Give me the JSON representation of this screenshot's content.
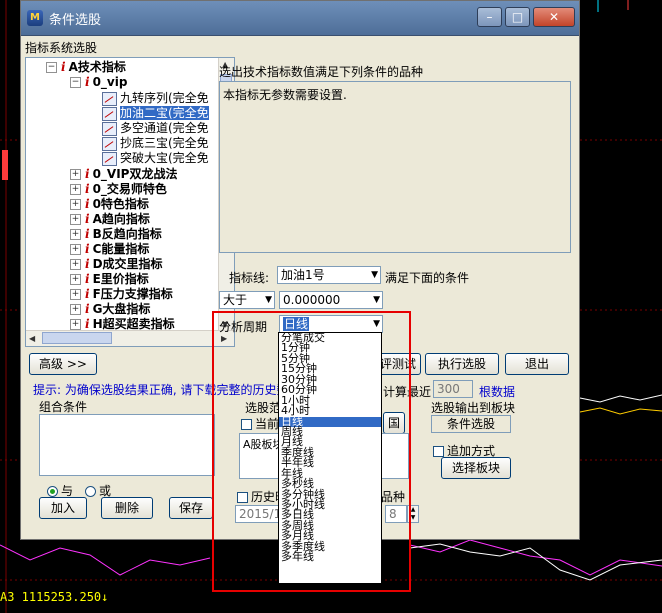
{
  "window": {
    "title": "条件选股",
    "icon_text": "M",
    "min_label": "–",
    "max_label": "□",
    "close_label": "✕"
  },
  "panel": {
    "group_label": "指标系统选股",
    "desc_label": "选出技术指标数值满足下列条件的品种",
    "desc_text": "本指标无参数需要设置."
  },
  "tree": {
    "items": [
      {
        "label": "A技术指标",
        "expander": "−",
        "prefix": "i"
      },
      {
        "label": "0_vip",
        "expander": "−",
        "prefix": "i"
      },
      {
        "label": "九转序列(完全免"
      },
      {
        "label": "加油二宝(完全免"
      },
      {
        "label": "多空通道(完全免"
      },
      {
        "label": "抄底三宝(完全免"
      },
      {
        "label": "突破大宝(完全免"
      },
      {
        "label": "0_VIP双龙战法",
        "expander": "+",
        "prefix": "i"
      },
      {
        "label": "0_交易师特色",
        "expander": "+",
        "prefix": "i"
      },
      {
        "label": "0特色指标",
        "expander": "+",
        "prefix": "i"
      },
      {
        "label": "A趋向指标",
        "expander": "+",
        "prefix": "i"
      },
      {
        "label": "B反趋向指标",
        "expander": "+",
        "prefix": "i"
      },
      {
        "label": "C能量指标",
        "expander": "+",
        "prefix": "i"
      },
      {
        "label": "D成交里指标",
        "expander": "+",
        "prefix": "i"
      },
      {
        "label": "E里价指标",
        "expander": "+",
        "prefix": "i"
      },
      {
        "label": "F压力支撑指标",
        "expander": "+",
        "prefix": "i"
      },
      {
        "label": "G大盘指标",
        "expander": "+",
        "prefix": "i"
      },
      {
        "label": "H超买超卖指标",
        "expander": "+",
        "prefix": "i"
      }
    ]
  },
  "controls": {
    "indicator_line_label": "指标线:",
    "indicator_line_value": "加油1号",
    "condition_suffix": "满足下面的条件",
    "operator_value": "大于",
    "threshold_value": "0.000000",
    "period_label": "分析周期",
    "period_value": "日线"
  },
  "buttons": {
    "advanced": "高级 >>",
    "backtest_partial": "评测试",
    "execute": "执行选股",
    "exit": "退出",
    "add": "加入",
    "delete": "删除",
    "save": "保存",
    "blocks_partial": "国",
    "select_block": "选择板块"
  },
  "hint": {
    "text": "提示: 为确保选股结果正确, 请下载完整的历史数",
    "calc_recent_label": "计算最近",
    "calc_recent_value": "300",
    "calc_recent_suffix": "根数据"
  },
  "combo_conditions": {
    "label": "组合条件",
    "radio_and": "与",
    "radio_or": "或"
  },
  "range": {
    "label": "选股范",
    "current_partial": "当前",
    "a_shares_partial": "A股板块",
    "history_partial": "历史时",
    "history_date_partial": "2015/12/",
    "species_partial": "品种",
    "species_count": "8"
  },
  "output": {
    "label": "选股输出到板块",
    "target_value": "条件选股",
    "append_label": "追加方式"
  },
  "period_dropdown": {
    "options": [
      "分笔成交",
      "1分钟",
      "5分钟",
      "15分钟",
      "30分钟",
      "60分钟",
      "1小时",
      "4小时",
      "日线",
      "周线",
      "月线",
      "季度线",
      "半年线",
      "年线",
      "多秒线",
      "多分钟线",
      "多小时线",
      "多日线",
      "多周线",
      "多月线",
      "多季度线",
      "多年线"
    ],
    "selected_index": 8
  },
  "background": {
    "status_text": "A3 1115253.250↓"
  },
  "colors": {
    "titlebar": "#5e7fab",
    "highlight": "#316ac5",
    "hint_blue": "#0000cc",
    "annotation_red": "#e60000"
  }
}
